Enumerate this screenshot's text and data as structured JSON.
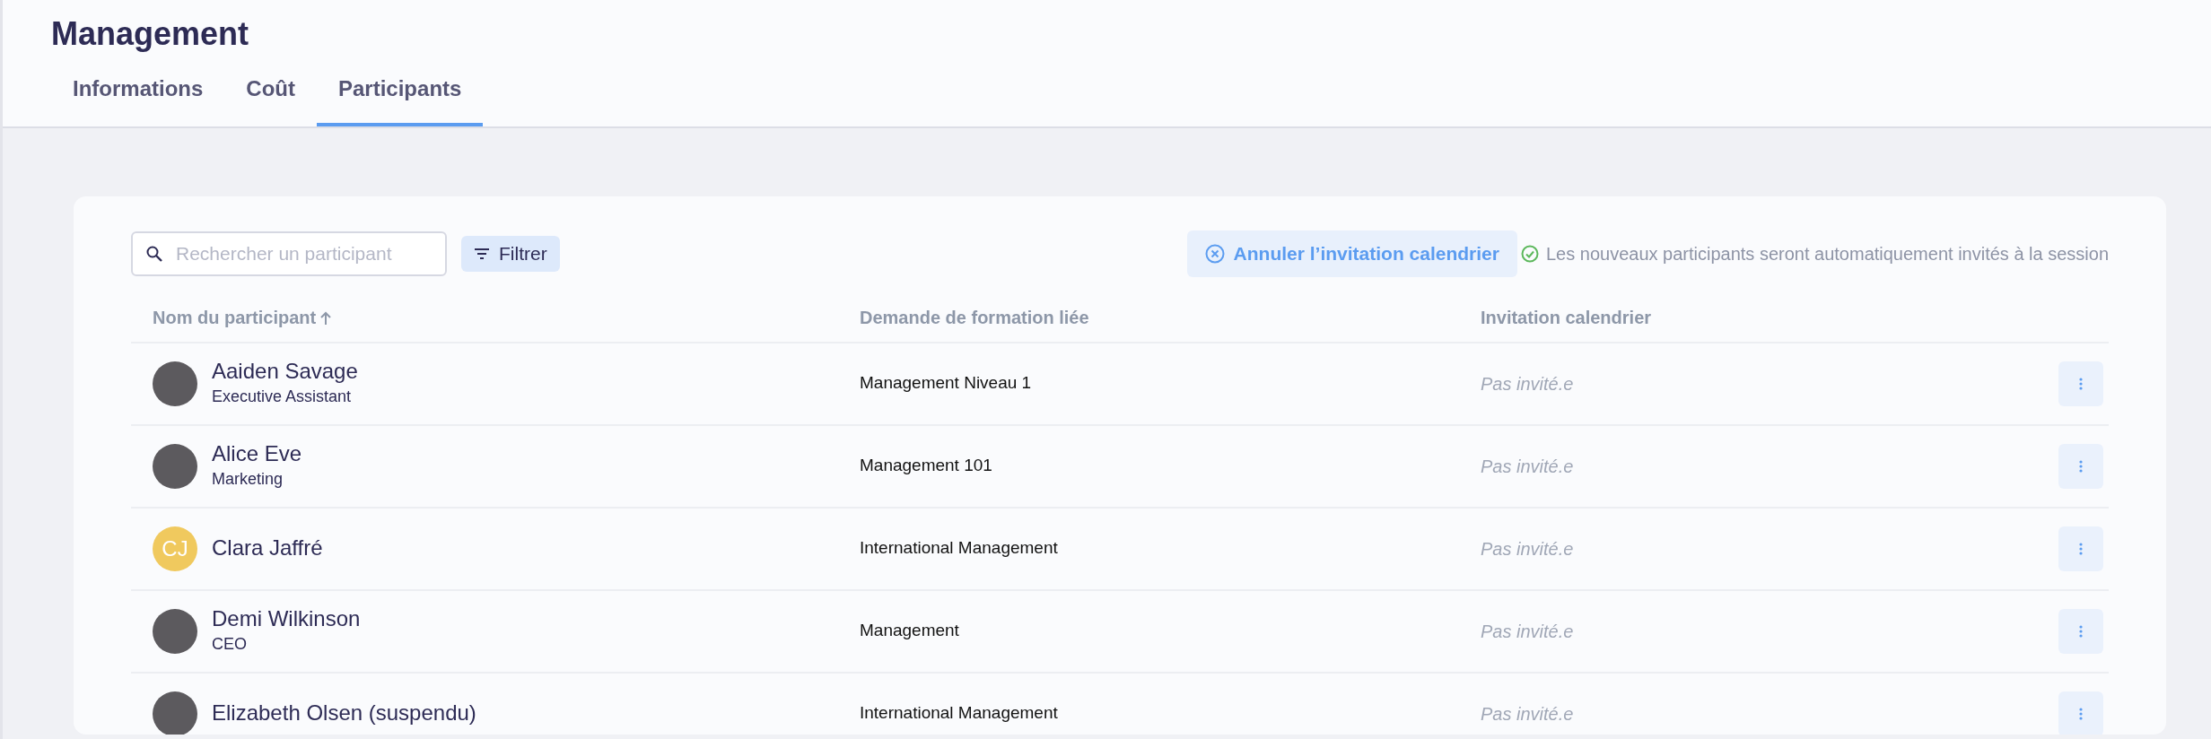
{
  "page": {
    "title": "Management"
  },
  "tabs": [
    {
      "label": "Informations",
      "selected": false
    },
    {
      "label": "Coût",
      "selected": false
    },
    {
      "label": "Participants",
      "selected": true
    }
  ],
  "toolbar": {
    "search": {
      "placeholder": "Rechercher un participant"
    },
    "filter_button": "Filtrer",
    "cancel_button": "Annuler l’invitation calendrier",
    "notice": "Les nouveaux participants seront automatiquement invités à la session"
  },
  "table": {
    "columns": [
      {
        "label": "Nom du participant",
        "sorted": true
      },
      {
        "label": "Demande de formation liée",
        "sorted": false
      },
      {
        "label": "Invitation calendrier",
        "sorted": false
      }
    ],
    "rows": [
      {
        "avatar": {
          "kind": "photo"
        },
        "name": "Aaiden Savage",
        "role": "Executive Assistant",
        "training": "Management Niveau 1",
        "invitation": "Pas invité.e"
      },
      {
        "avatar": {
          "kind": "photo"
        },
        "name": "Alice Eve",
        "role": "Marketing",
        "training": "Management 101",
        "invitation": "Pas invité.e"
      },
      {
        "avatar": {
          "kind": "initials",
          "initials": "CJ"
        },
        "name": "Clara Jaffré",
        "training": "International Management",
        "invitation": "Pas invité.e"
      },
      {
        "avatar": {
          "kind": "photo"
        },
        "name": "Demi Wilkinson",
        "role": "CEO",
        "training": "Management",
        "invitation": "Pas invité.e"
      },
      {
        "avatar": {
          "kind": "photo"
        },
        "name": "Elizabeth Olsen (suspendu)",
        "training": "International Management",
        "invitation": "Pas invité.e"
      }
    ]
  }
}
